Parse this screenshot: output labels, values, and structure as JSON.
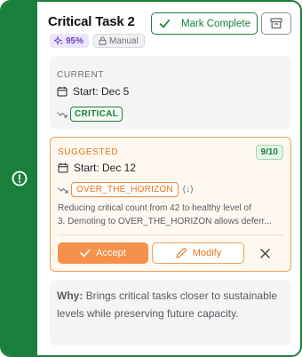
{
  "task": {
    "title": "Critical Task 2",
    "mark_complete_label": "Mark Complete",
    "confidence": "95%",
    "mode": "Manual"
  },
  "current": {
    "label": "CURRENT",
    "start": "Start: Dec 5",
    "status": "CRITICAL"
  },
  "suggested": {
    "label": "SUGGESTED",
    "score": "9/10",
    "start": "Start: Dec 12",
    "status": "OVER_THE_HORIZON",
    "direction": "(↓)",
    "reason_line1": "Reducing critical count from 42 to healthy level of",
    "reason_line2": "3. Demoting to OVER_THE_HORIZON allows deferr...",
    "accept_label": "Accept",
    "modify_label": "Modify"
  },
  "why": {
    "label": "Why:",
    "text": "Brings critical tasks closer to sustainable levels while preserving future capacity."
  },
  "colors": {
    "accent_green": "#1a7f3a",
    "suggest_orange": "#f5914a",
    "confidence_purple": "#6a3fc4"
  },
  "icons": {
    "rail": "alert-circle-icon",
    "complete": "check-icon",
    "archive": "archive-icon",
    "confidence": "sparkles-icon",
    "mode": "lock-icon",
    "date": "calendar-icon",
    "status": "trend-icon",
    "accept": "check-icon",
    "modify": "pencil-icon",
    "dismiss": "close-icon"
  }
}
